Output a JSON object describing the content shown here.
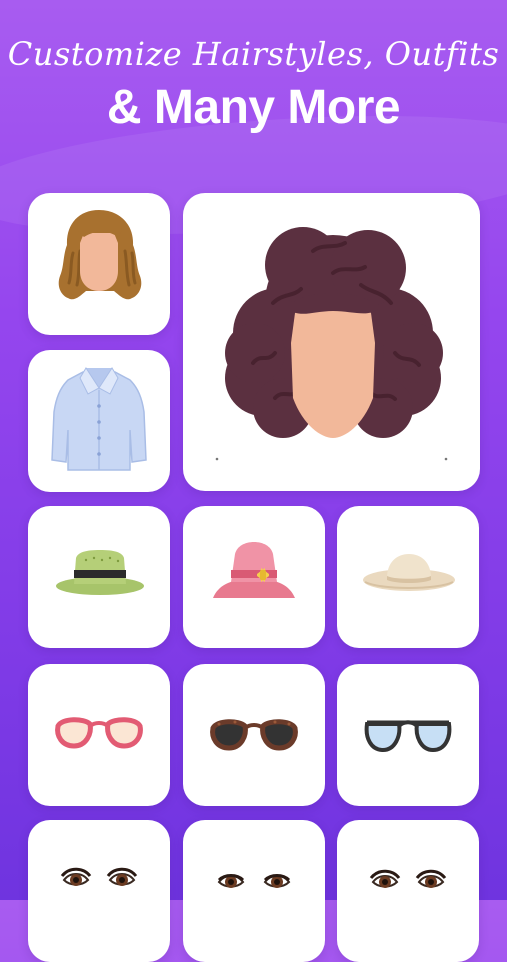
{
  "header": {
    "subtitle": "Customize Hairstyles, Outfits",
    "title": "& Many More"
  },
  "items": {
    "hairstyle_small": {
      "icon": "wavy-brown-hair-icon"
    },
    "outfit_shirt": {
      "icon": "blue-shirt-icon"
    },
    "hairstyle_large": {
      "icon": "curly-dark-hair-icon"
    },
    "hat_green": {
      "icon": "green-boater-hat-icon"
    },
    "hat_pink": {
      "icon": "pink-bucket-hat-icon"
    },
    "hat_beige": {
      "icon": "beige-sun-hat-icon"
    },
    "glasses_pink": {
      "icon": "pink-cateye-glasses-icon"
    },
    "glasses_dark": {
      "icon": "dark-sunglasses-icon"
    },
    "glasses_blue": {
      "icon": "blue-aviator-glasses-icon"
    },
    "eyes_1": {
      "icon": "eyes-style-1-icon"
    },
    "eyes_2": {
      "icon": "eyes-style-2-icon"
    },
    "eyes_3": {
      "icon": "eyes-style-3-icon"
    }
  },
  "colors": {
    "background_top": "#a85cf0",
    "background_bottom": "#6f34df",
    "tile": "#ffffff",
    "skin": "#f2b89a",
    "brown_hair": "#a8712f",
    "dark_hair": "#5b3040"
  }
}
